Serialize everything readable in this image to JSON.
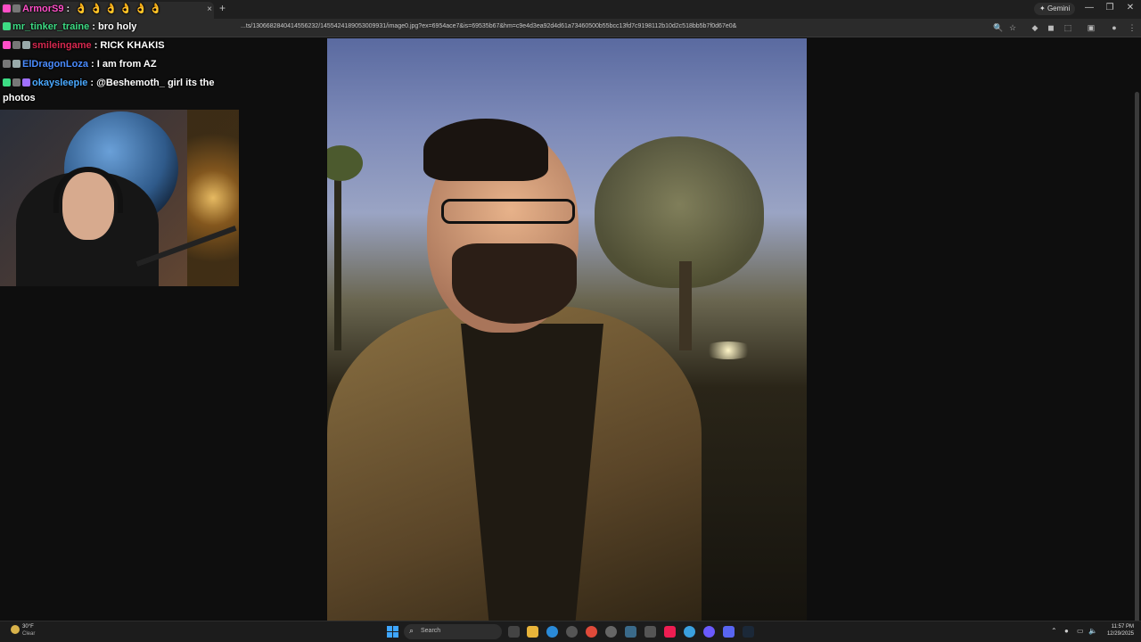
{
  "browser": {
    "url": "...ts/1306682840414556232/1455424189053009931/image0.jpg?ex=6954ace7&is=69535b67&hm=c9e4d3ea92d4d61a73460500b55bcc13fd7c9198112b10d2c518bb5b7f0d67e0&",
    "gemini_label": "Gemini",
    "tab_close": "×",
    "new_tab": "+"
  },
  "chat": {
    "messages": [
      {
        "username": "ArmorS9",
        "separator": " : ",
        "text": "",
        "emotes": [
          "👌",
          "👌",
          "👌",
          "👌",
          "👌",
          "👌"
        ]
      },
      {
        "username": "mr_tinker_traine",
        "separator": " : ",
        "text": "bro holy",
        "emotes": []
      },
      {
        "username": "smileingame",
        "separator": " : ",
        "text": "RICK KHAKIS",
        "emotes": []
      },
      {
        "username": "ElDragonLoza",
        "separator": " : ",
        "text": "I am from AZ",
        "emotes": []
      },
      {
        "username": "okaysleepie",
        "separator": " : ",
        "text": "@Beshemoth_ girl its the",
        "text2": "photos",
        "emotes": []
      }
    ]
  },
  "taskbar": {
    "weather_temp": "30°F",
    "weather_condition": "Clear",
    "search_label": "Search",
    "time": "11:57 PM",
    "date": "12/29/2025"
  },
  "colors": {
    "accent": "#3ea6ff",
    "background": "#0e0e0e"
  }
}
